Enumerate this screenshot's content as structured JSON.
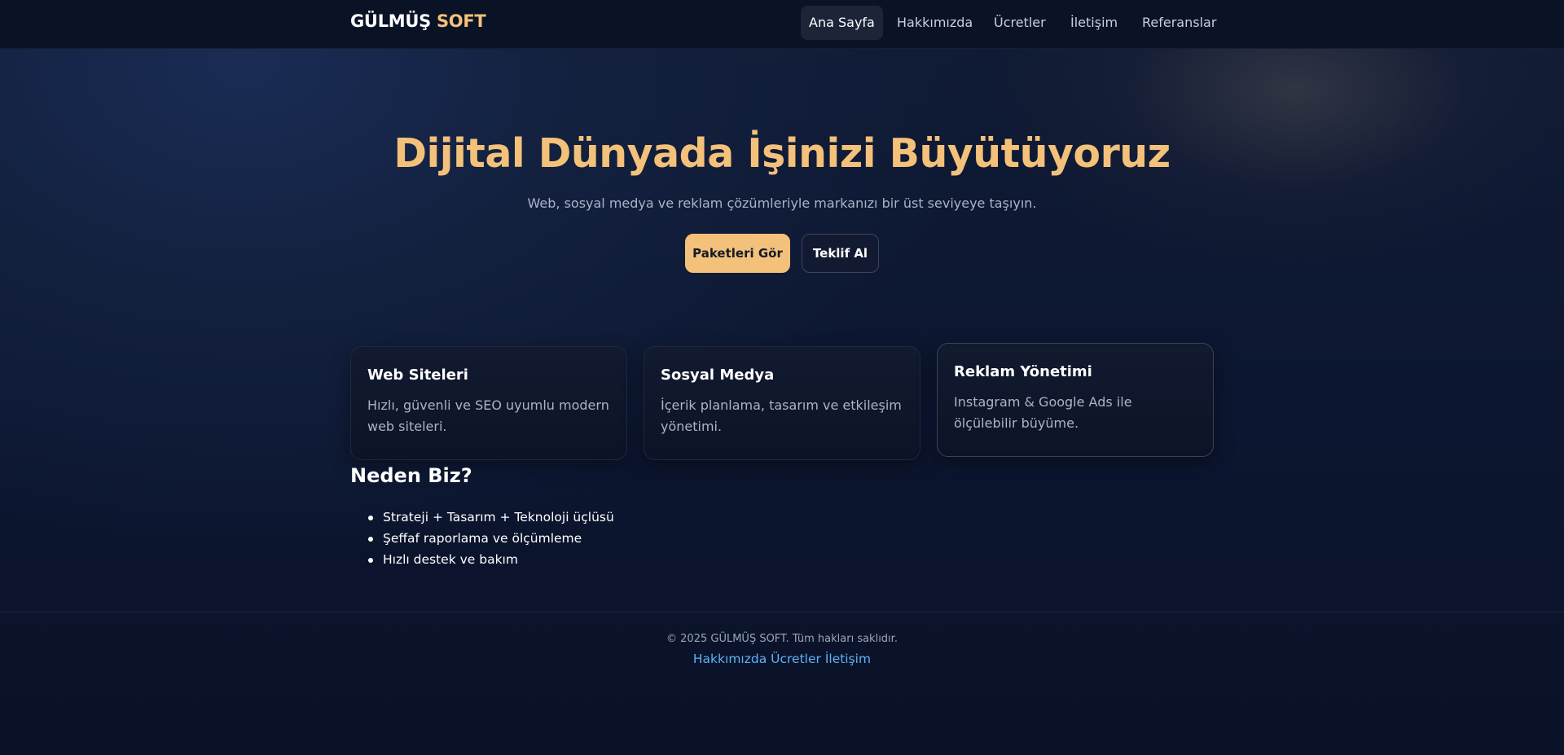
{
  "header": {
    "brand_main": "GÜLMÜŞ",
    "brand_accent": "SOFT",
    "nav": [
      {
        "label": "Ana Sayfa",
        "active": true
      },
      {
        "label": "Hakkımızda",
        "active": false
      },
      {
        "label": "Ücretler",
        "active": false
      },
      {
        "label": "İletişim",
        "active": false
      },
      {
        "label": "Referanslar",
        "active": false
      }
    ]
  },
  "hero": {
    "title": "Dijital Dünyada İşinizi Büyütüyoruz",
    "subtitle": "Web, sosyal medya ve reklam çözümleriyle markanızı bir üst seviyeye taşıyın.",
    "primary_button": "Paketleri Gör",
    "secondary_button": "Teklif Al"
  },
  "services": [
    {
      "title": "Web Siteleri",
      "description": "Hızlı, güvenli ve SEO uyumlu modern web siteleri."
    },
    {
      "title": "Sosyal Medya",
      "description": "İçerik planlama, tasarım ve etkileşim yönetimi."
    },
    {
      "title": "Reklam Yönetimi",
      "description": "Instagram & Google Ads ile ölçülebilir büyüme."
    }
  ],
  "why": {
    "title": "Neden Biz?",
    "items": [
      "Strateji + Tasarım + Teknoloji üçlüsü",
      "Şeffaf raporlama ve ölçümleme",
      "Hızlı destek ve bakım"
    ]
  },
  "footer": {
    "copyright": "© 2025 GÜLMÜŞ SOFT. Tüm hakları saklıdır.",
    "links": [
      "Hakkımızda",
      "Ücretler",
      "İletişim"
    ]
  },
  "colors": {
    "accent": "#f3c17a",
    "link": "#5fb2f5",
    "background": "#0c1630"
  }
}
